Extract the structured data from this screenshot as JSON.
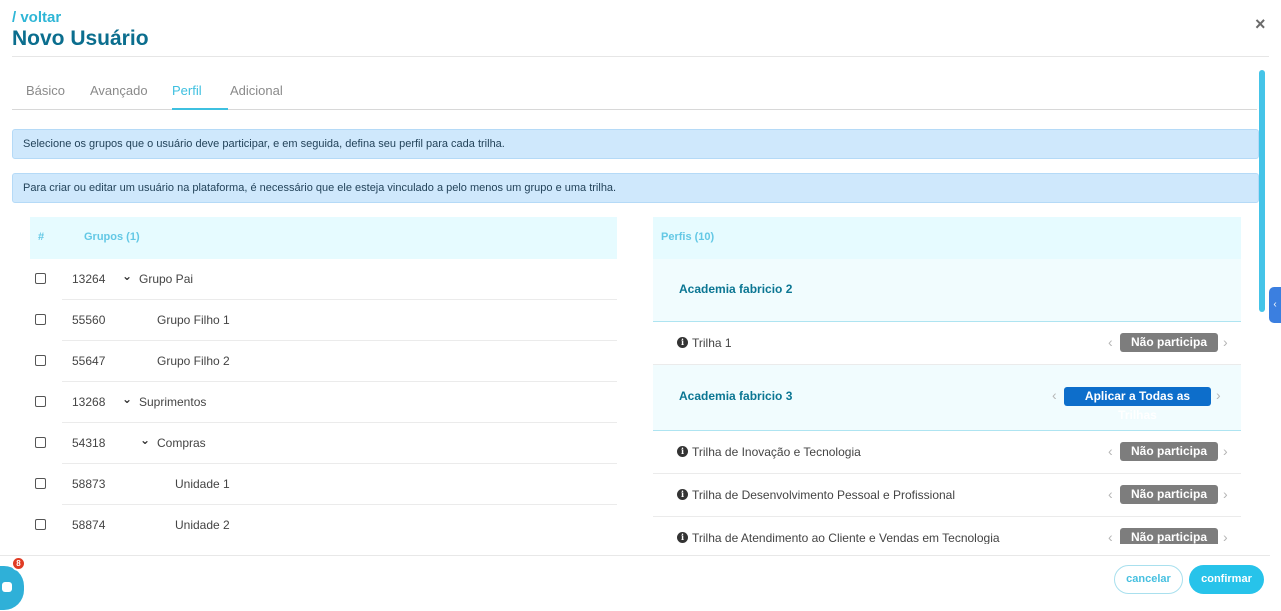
{
  "header": {
    "back_label": "/ voltar",
    "title": "Novo Usuário",
    "close_symbol": "×"
  },
  "tabs": [
    {
      "label": "Básico",
      "active": false
    },
    {
      "label": "Avançado",
      "active": false
    },
    {
      "label": "Perfil",
      "active": true
    },
    {
      "label": "Adicional",
      "active": false
    }
  ],
  "alerts": [
    "Selecione os grupos que o usuário deve participar, e em seguida, defina seu perfil para cada trilha.",
    "Para criar ou editar um usuário na plataforma, é necessário que ele esteja vinculado a pelo menos um grupo e uma trilha."
  ],
  "groups": {
    "col_hash": "#",
    "col_title": "Grupos (1)",
    "rows": [
      {
        "id": "13264",
        "name": "Grupo Pai",
        "expandable": true
      },
      {
        "id": "55560",
        "name": "Grupo Filho 1",
        "expandable": false
      },
      {
        "id": "55647",
        "name": "Grupo Filho 2",
        "expandable": false
      },
      {
        "id": "13268",
        "name": "Suprimentos",
        "expandable": true
      },
      {
        "id": "54318",
        "name": "Compras",
        "expandable": true
      },
      {
        "id": "58873",
        "name": "Unidade 1",
        "expandable": false
      },
      {
        "id": "58874",
        "name": "Unidade 2",
        "expandable": false
      }
    ]
  },
  "profiles": {
    "title": "Perfis (10)",
    "academia_1": "Academia fabricio 2",
    "academia_2": "Academia fabricio 3",
    "apply_all_label": "Aplicar a Todas as Trilhas",
    "trilhas": [
      {
        "name": "Trilha 1",
        "status": "Não participa"
      },
      {
        "name": "Trilha de Inovação e Tecnologia",
        "status": "Não participa"
      },
      {
        "name": "Trilha de Desenvolvimento Pessoal e Profissional",
        "status": "Não participa"
      },
      {
        "name": "Trilha de Atendimento ao Cliente e Vendas em Tecnologia",
        "status": "Não participa"
      }
    ],
    "arrow_left": "‹",
    "arrow_right": "›"
  },
  "footer": {
    "cancel_label": "cancelar",
    "confirm_label": "confirmar"
  },
  "chat": {
    "badge_count": "8"
  },
  "colors": {
    "accent": "#27c3ea",
    "title": "#0b6e8e",
    "badge_gray": "#7d7d7d",
    "apply_blue": "#0d6ecb"
  }
}
